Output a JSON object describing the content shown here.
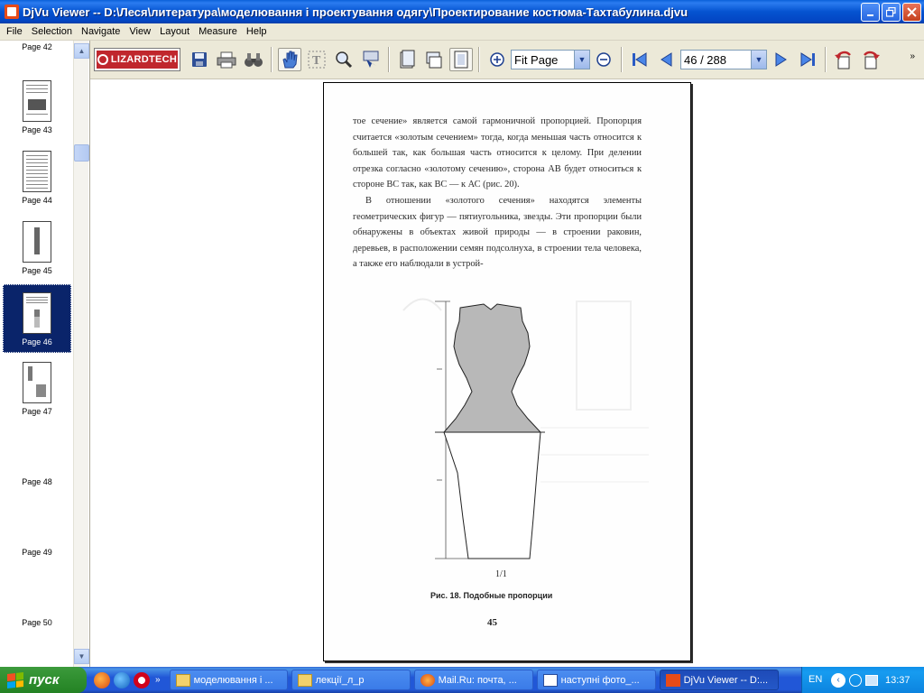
{
  "window": {
    "title": "DjVu Viewer -- D:\\Леся\\литература\\моделювання і проектування одягу\\Проектирование костюма-Тахтабулина.djvu"
  },
  "menu": [
    "File",
    "Selection",
    "Navigate",
    "View",
    "Layout",
    "Measure",
    "Help"
  ],
  "toolbar": {
    "logo_text": "LIZARDTECH",
    "zoom_value": "Fit Page",
    "page_value": "46 / 288"
  },
  "thumbnails": [
    {
      "label": "Page 42"
    },
    {
      "label": "Page 43"
    },
    {
      "label": "Page 44"
    },
    {
      "label": "Page 45"
    },
    {
      "label": "Page 46",
      "selected": true
    },
    {
      "label": "Page 47"
    },
    {
      "label": "Page 48"
    },
    {
      "label": "Page 49"
    },
    {
      "label": "Page 50"
    }
  ],
  "document": {
    "paragraph1": "тое сечение» является самой гармоничной пропорцией. Пропорция считается «золотым сечением» тогда, когда меньшая часть относится к большей так, как большая часть относится к целому. При делении отрезка согласно «золотому сечению», сторона АВ будет относиться к стороне ВС так, как ВС — к АС (рис. 20).",
    "paragraph2": "В отношении «золотого сечения» находятся элементы геометрических фигур — пятиугольника, звезды. Эти пропорции были обнаружены в объектах живой природы — в строении раковин, деревьев, в расположении семян подсолнуха, в строении тела человека, а также его наблюдали в устрой-",
    "figure_label": "1/1",
    "figure_caption": "Рис. 18. Подобные пропорции",
    "page_number": "45"
  },
  "taskbar": {
    "start_label": "пуск",
    "buttons": [
      {
        "label": "моделювання і ...",
        "icon": "folder-icon"
      },
      {
        "label": "лекції_л_р",
        "icon": "folder-icon"
      },
      {
        "label": "Mail.Ru: почта, ...",
        "icon": "firefox-icon"
      },
      {
        "label": "наступні фото_...",
        "icon": "word-icon"
      },
      {
        "label": "DjVu Viewer -- D:...",
        "icon": "djvu-icon",
        "active": true
      }
    ],
    "language": "EN",
    "clock": "13:37"
  }
}
